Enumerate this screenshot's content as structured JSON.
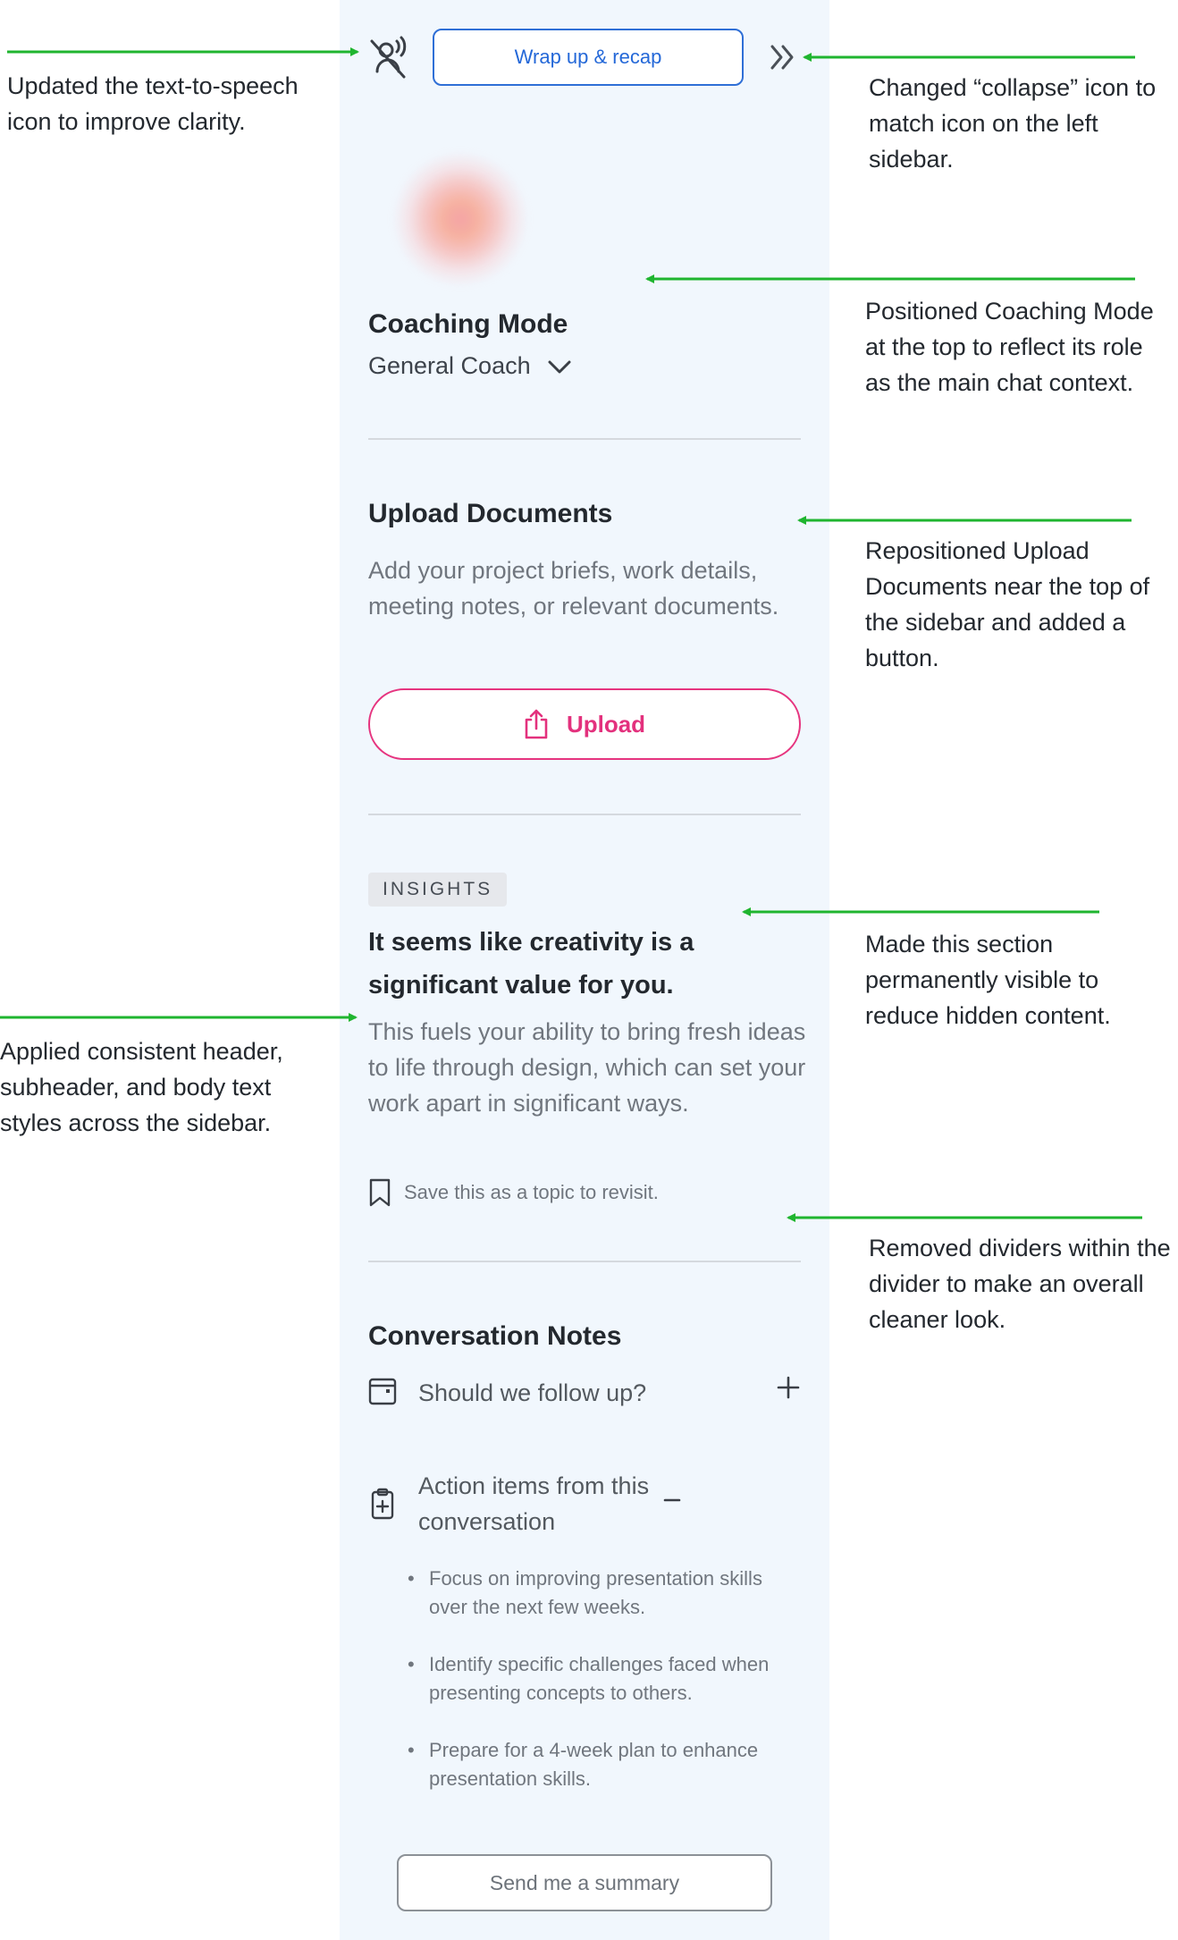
{
  "sidebar": {
    "wrap_button": "Wrap up & recap",
    "coaching": {
      "title": "Coaching Mode",
      "mode": "General Coach"
    },
    "upload": {
      "title": "Upload Documents",
      "description": "Add your project briefs, work details, meeting notes, or relevant documents.",
      "button_label": "Upload"
    },
    "insights": {
      "badge": "INSIGHTS",
      "heading": "It seems like creativity is a significant value for you.",
      "body": "This fuels your ability to bring fresh ideas to life through design, which can set your work apart in significant ways.",
      "save_label": "Save this as a topic to revisit."
    },
    "notes": {
      "title": "Conversation Notes",
      "follow_up": "Should we follow up?",
      "action_items_label": "Action items from this conversation",
      "action_items": [
        "Focus on improving presentation skills over the next few weeks.",
        "Identify specific challenges faced when presenting concepts to others.",
        "Prepare for a 4-week plan to enhance presentation skills."
      ],
      "summary_button": "Send me a summary"
    }
  },
  "annotations": {
    "tts": "Updated the text-to-speech icon to improve clarity.",
    "collapse": "Changed “collapse” icon to match icon on the left sidebar.",
    "coaching": "Positioned Coaching Mode at the top to reflect its role as the main chat context.",
    "upload": "Repositioned Upload Documents near the top of the sidebar and added a button.",
    "insights": "Made this section permanently visible to reduce hidden content.",
    "styles": "Applied consistent header, subheader, and body text styles across the sidebar.",
    "dividers": "Removed dividers within the divider to make an overall cleaner look."
  },
  "colors": {
    "sidebar_bg": "#f1f7fd",
    "accent_blue": "#2f6fd6",
    "accent_pink": "#e6347f",
    "arrow_green": "#1fb52f"
  }
}
